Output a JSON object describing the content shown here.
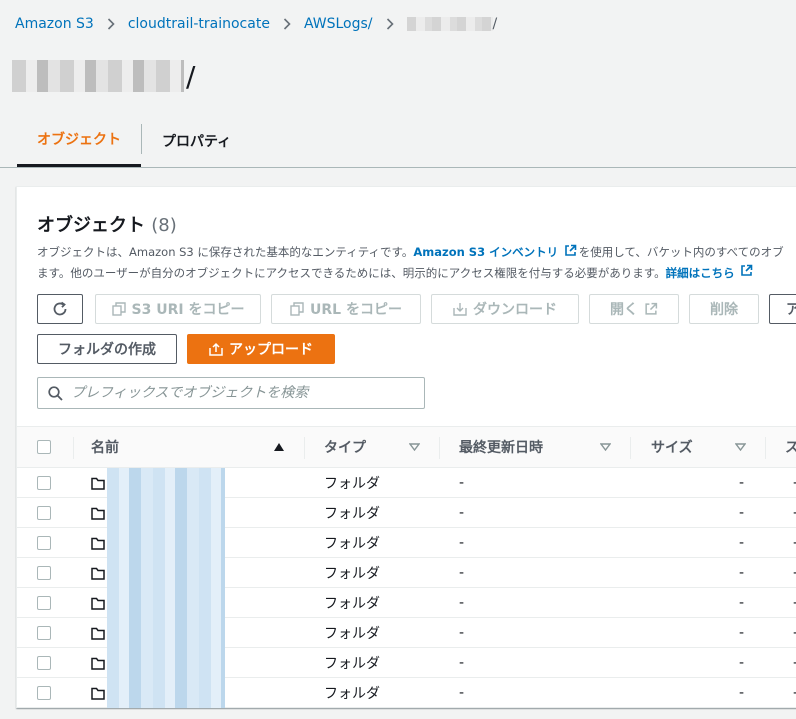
{
  "breadcrumb": {
    "items": [
      "Amazon S3",
      "cloudtrail-trainocate",
      "AWSLogs/"
    ],
    "last_suffix": "/"
  },
  "page": {
    "title_suffix": "/"
  },
  "tabs": [
    {
      "label": "オブジェクト",
      "active": true
    },
    {
      "label": "プロパティ",
      "active": false
    }
  ],
  "objects_panel": {
    "heading": "オブジェクト",
    "count": "(8)",
    "desc_part1": "オブジェクトは、Amazon S3 に保存された基本的なエンティティです。",
    "desc_link1": "Amazon S3 インベントリ",
    "desc_part2": "を使用して、バケット内のすべてのオブ",
    "desc_part3": "ます。他のユーザーが自分のオブジェクトにアクセスできるためには、明示的にアクセス権限を付与する必要があります。",
    "desc_link2": "詳細はこちら"
  },
  "toolbar": {
    "copy_s3_uri": "S3 URI をコピー",
    "copy_url": "URL をコピー",
    "download": "ダウンロード",
    "open": "開く",
    "delete": "削除",
    "actions_partial": "ア",
    "create_folder": "フォルダの作成",
    "upload": "アップロード"
  },
  "search": {
    "placeholder": "プレフィックスでオブジェクトを検索"
  },
  "table": {
    "columns": {
      "name": "名前",
      "type": "タイプ",
      "last_modified": "最終更新日時",
      "size": "サイズ",
      "storage_partial": "ス"
    },
    "rows": [
      {
        "type": "フォルダ",
        "last_modified": "-",
        "size": "-"
      },
      {
        "type": "フォルダ",
        "last_modified": "-",
        "size": "-"
      },
      {
        "type": "フォルダ",
        "last_modified": "-",
        "size": "-"
      },
      {
        "type": "フォルダ",
        "last_modified": "-",
        "size": "-"
      },
      {
        "type": "フォルダ",
        "last_modified": "-",
        "size": "-"
      },
      {
        "type": "フォルダ",
        "last_modified": "-",
        "size": "-"
      },
      {
        "type": "フォルダ",
        "last_modified": "-",
        "size": "-"
      },
      {
        "type": "フォルダ",
        "last_modified": "-",
        "size": "-"
      }
    ]
  },
  "colors": {
    "accent": "#ec7211",
    "link": "#0073bb"
  }
}
